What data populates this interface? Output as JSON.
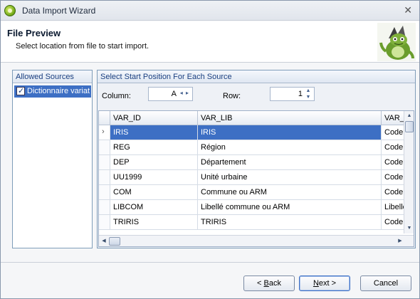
{
  "window": {
    "title": "Data Import Wizard",
    "close_glyph": "✕"
  },
  "header": {
    "title": "File Preview",
    "subtitle": "Select location from file to start import."
  },
  "sources": {
    "heading": "Allowed Sources",
    "items": [
      {
        "label": "Dictionnaire variat",
        "checked": true
      }
    ]
  },
  "start_position": {
    "heading": "Select Start Position For Each Source",
    "column_label": "Column:",
    "column_value": "A",
    "row_label": "Row:",
    "row_value": "1"
  },
  "grid": {
    "columns": [
      "VAR_ID",
      "VAR_LIB",
      "VAR_"
    ],
    "rows": [
      [
        "IRIS",
        "IRIS",
        "Code"
      ],
      [
        "REG",
        "Région",
        "Code"
      ],
      [
        "DEP",
        "Département",
        "Code"
      ],
      [
        "UU1999",
        "Unité urbaine",
        "Code"
      ],
      [
        "COM",
        "Commune ou ARM",
        "Code"
      ],
      [
        "LIBCOM",
        "Libellé commune ou ARM",
        "Libellé"
      ],
      [
        "TRIRIS",
        "TRIRIS",
        "Code"
      ]
    ],
    "selected_row": 0,
    "row_indicator": "›"
  },
  "buttons": {
    "back_prefix": "< ",
    "back_mnemonic": "B",
    "back_rest": "ack",
    "next_mnemonic": "N",
    "next_rest": "ext >",
    "cancel": "Cancel"
  },
  "colors": {
    "selection": "#3d6fc4",
    "accent_text": "#1a3f80"
  }
}
